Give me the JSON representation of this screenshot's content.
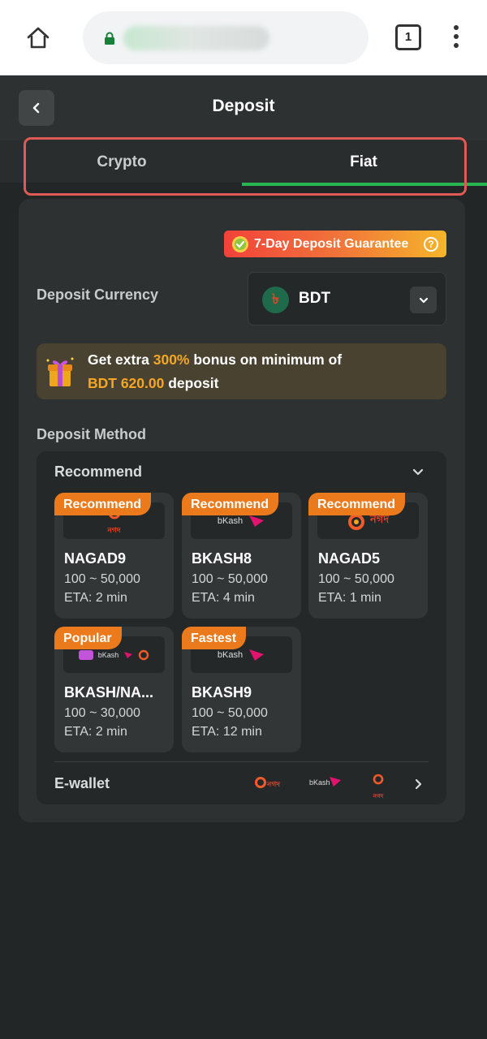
{
  "browser": {
    "url": "",
    "tab_count": "1",
    "icons": {
      "home": "home-icon",
      "lock": "lock-icon",
      "menu": "more-vert-icon"
    }
  },
  "header": {
    "title": "Deposit",
    "back_icon": "chevron-left-icon"
  },
  "tabs": [
    {
      "label": "Crypto",
      "active": false
    },
    {
      "label": "Fiat",
      "active": true
    }
  ],
  "guarantee": {
    "label": "7-Day Deposit Guarantee",
    "help_icon": "question-circle-icon"
  },
  "currency": {
    "label": "Deposit Currency",
    "selected": "BDT",
    "symbol": "৳"
  },
  "bonus": {
    "prefix": "Get extra ",
    "percent": "300%",
    "middle": " bonus on minimum of",
    "amount": "BDT 620.00",
    "suffix": " deposit"
  },
  "deposit_method": {
    "label": "Deposit Method",
    "group_title": "Recommend",
    "methods": [
      {
        "badge": "Recommend",
        "name": "NAGAD9",
        "range": "100 ~ 50,000",
        "eta": "ETA: 2 min",
        "logo": "nagad"
      },
      {
        "badge": "Recommend",
        "name": "BKASH8",
        "range": "100 ~ 50,000",
        "eta": "ETA: 4 min",
        "logo": "bkash"
      },
      {
        "badge": "Recommend",
        "name": "NAGAD5",
        "range": "100 ~ 50,000",
        "eta": "ETA: 1 min",
        "logo": "nagad"
      },
      {
        "badge": "Popular",
        "name": "BKASH/NA...",
        "range": "100 ~ 30,000",
        "eta": "ETA: 2 min",
        "logo": "multi"
      },
      {
        "badge": "Fastest",
        "name": "BKASH9",
        "range": "100 ~ 50,000",
        "eta": "ETA: 12 min",
        "logo": "bkash"
      }
    ],
    "ewallet_label": "E-wallet",
    "logo_text": {
      "nagad": "নগদ",
      "bkash": "bKash"
    }
  },
  "colors": {
    "background": "#232626",
    "card": "#2e3131",
    "accent_green": "#27b451",
    "badge_orange": "#ea7a1c",
    "highlight_red": "#e05a55",
    "bonus_orange": "#f5a623"
  }
}
